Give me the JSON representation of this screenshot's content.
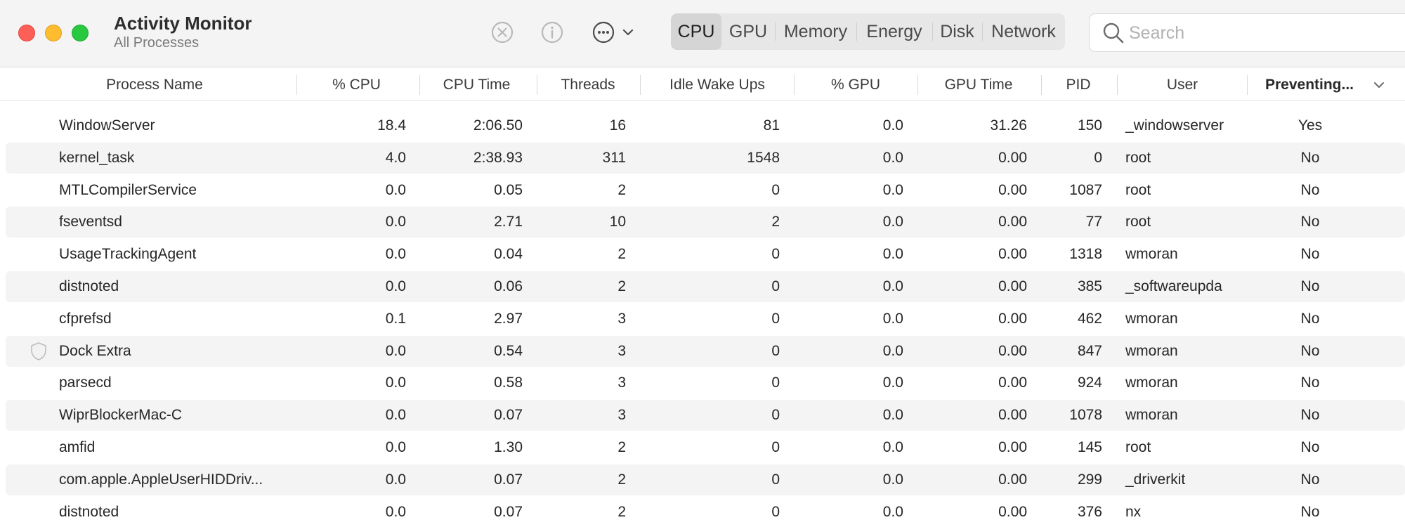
{
  "window": {
    "title": "Activity Monitor",
    "subtitle": "All Processes"
  },
  "toolbar": {
    "stop_icon": "x-circle-icon",
    "info_icon": "info-circle-icon",
    "more_icon": "ellipsis-circle-icon",
    "tabs": [
      "CPU",
      "GPU",
      "Memory",
      "Energy",
      "Disk",
      "Network"
    ],
    "active_tab": "CPU"
  },
  "search": {
    "placeholder": "Search"
  },
  "table": {
    "columns": [
      "Process Name",
      "% CPU",
      "CPU Time",
      "Threads",
      "Idle Wake Ups",
      "% GPU",
      "GPU Time",
      "PID",
      "User",
      "Preventing..."
    ],
    "sorted_column": "Preventing...",
    "sort_direction": "descending",
    "rows": [
      {
        "icon": "",
        "name": "WindowServer",
        "cpu": "18.4",
        "cpu_time": "2:06.50",
        "threads": "16",
        "idle_wake_ups": "81",
        "gpu": "0.0",
        "gpu_time": "31.26",
        "pid": "150",
        "user": "_windowserver",
        "preventing": "Yes"
      },
      {
        "icon": "",
        "name": "kernel_task",
        "cpu": "4.0",
        "cpu_time": "2:38.93",
        "threads": "311",
        "idle_wake_ups": "1548",
        "gpu": "0.0",
        "gpu_time": "0.00",
        "pid": "0",
        "user": "root",
        "preventing": "No"
      },
      {
        "icon": "",
        "name": "MTLCompilerService",
        "cpu": "0.0",
        "cpu_time": "0.05",
        "threads": "2",
        "idle_wake_ups": "0",
        "gpu": "0.0",
        "gpu_time": "0.00",
        "pid": "1087",
        "user": "root",
        "preventing": "No"
      },
      {
        "icon": "",
        "name": "fseventsd",
        "cpu": "0.0",
        "cpu_time": "2.71",
        "threads": "10",
        "idle_wake_ups": "2",
        "gpu": "0.0",
        "gpu_time": "0.00",
        "pid": "77",
        "user": "root",
        "preventing": "No"
      },
      {
        "icon": "",
        "name": "UsageTrackingAgent",
        "cpu": "0.0",
        "cpu_time": "0.04",
        "threads": "2",
        "idle_wake_ups": "0",
        "gpu": "0.0",
        "gpu_time": "0.00",
        "pid": "1318",
        "user": "wmoran",
        "preventing": "No"
      },
      {
        "icon": "",
        "name": "distnoted",
        "cpu": "0.0",
        "cpu_time": "0.06",
        "threads": "2",
        "idle_wake_ups": "0",
        "gpu": "0.0",
        "gpu_time": "0.00",
        "pid": "385",
        "user": "_softwareupda",
        "preventing": "No"
      },
      {
        "icon": "",
        "name": "cfprefsd",
        "cpu": "0.1",
        "cpu_time": "2.97",
        "threads": "3",
        "idle_wake_ups": "0",
        "gpu": "0.0",
        "gpu_time": "0.00",
        "pid": "462",
        "user": "wmoran",
        "preventing": "No"
      },
      {
        "icon": "shield-icon",
        "name": "Dock Extra",
        "cpu": "0.0",
        "cpu_time": "0.54",
        "threads": "3",
        "idle_wake_ups": "0",
        "gpu": "0.0",
        "gpu_time": "0.00",
        "pid": "847",
        "user": "wmoran",
        "preventing": "No"
      },
      {
        "icon": "",
        "name": "parsecd",
        "cpu": "0.0",
        "cpu_time": "0.58",
        "threads": "3",
        "idle_wake_ups": "0",
        "gpu": "0.0",
        "gpu_time": "0.00",
        "pid": "924",
        "user": "wmoran",
        "preventing": "No"
      },
      {
        "icon": "",
        "name": "WiprBlockerMac-C",
        "cpu": "0.0",
        "cpu_time": "0.07",
        "threads": "3",
        "idle_wake_ups": "0",
        "gpu": "0.0",
        "gpu_time": "0.00",
        "pid": "1078",
        "user": "wmoran",
        "preventing": "No"
      },
      {
        "icon": "",
        "name": "amfid",
        "cpu": "0.0",
        "cpu_time": "1.30",
        "threads": "2",
        "idle_wake_ups": "0",
        "gpu": "0.0",
        "gpu_time": "0.00",
        "pid": "145",
        "user": "root",
        "preventing": "No"
      },
      {
        "icon": "",
        "name": "com.apple.AppleUserHIDDriv...",
        "cpu": "0.0",
        "cpu_time": "0.07",
        "threads": "2",
        "idle_wake_ups": "0",
        "gpu": "0.0",
        "gpu_time": "0.00",
        "pid": "299",
        "user": "_driverkit",
        "preventing": "No"
      },
      {
        "icon": "",
        "name": "distnoted",
        "cpu": "0.0",
        "cpu_time": "0.07",
        "threads": "2",
        "idle_wake_ups": "0",
        "gpu": "0.0",
        "gpu_time": "0.00",
        "pid": "376",
        "user": "nx",
        "preventing": "No"
      }
    ]
  },
  "colors": {
    "close": "#fe5f57",
    "minimize": "#febc2e",
    "maximize": "#28c840",
    "row_stripe": "#f4f4f4",
    "active_tab": "#d6d5d5"
  }
}
